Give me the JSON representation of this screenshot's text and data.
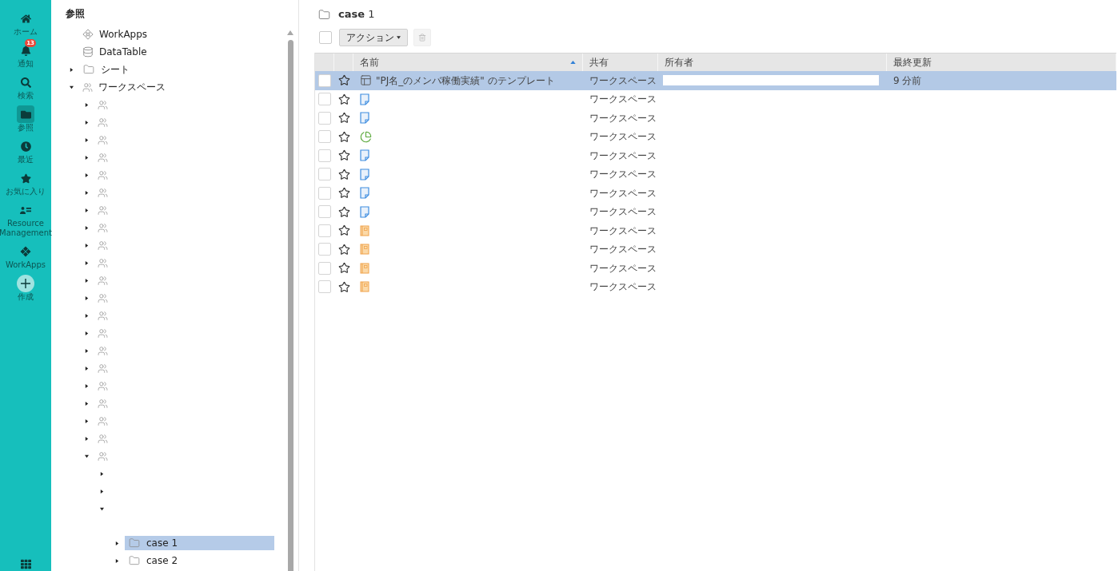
{
  "nav": {
    "items": [
      {
        "kind": "home",
        "label": "ホーム",
        "selected": false
      },
      {
        "kind": "bell",
        "label": "通知",
        "selected": false,
        "badge": "13"
      },
      {
        "kind": "search",
        "label": "検索",
        "selected": false
      },
      {
        "kind": "folder",
        "label": "参照",
        "selected": true
      },
      {
        "kind": "clock",
        "label": "最近",
        "selected": false
      },
      {
        "kind": "star",
        "label": "お気に入り",
        "selected": false
      },
      {
        "kind": "resource",
        "label": "Resource Management",
        "selected": false
      },
      {
        "kind": "workapps",
        "label": "WorkApps",
        "selected": false
      },
      {
        "kind": "create",
        "label": "作成",
        "selected": false
      }
    ]
  },
  "tree": {
    "title": "参照",
    "items": [
      {
        "kind": "workapps",
        "label": "WorkApps",
        "selected": false
      },
      {
        "kind": "database",
        "label": "DataTable",
        "selected": false
      },
      {
        "kind": "folder",
        "label": "シート",
        "expanded": false,
        "selected": false
      },
      {
        "kind": "workspace",
        "label": "ワークスペース",
        "expanded": true,
        "selected": false,
        "children": [
          {
            "kind": "workspace",
            "expanded": false,
            "selected": false
          },
          {
            "kind": "workspace",
            "expanded": false,
            "selected": false
          },
          {
            "kind": "workspace",
            "expanded": false,
            "selected": false
          },
          {
            "kind": "workspace",
            "expanded": false,
            "selected": false
          },
          {
            "kind": "workspace",
            "expanded": false,
            "selected": false
          },
          {
            "kind": "workspace",
            "expanded": false,
            "selected": false
          },
          {
            "kind": "workspace",
            "expanded": false,
            "selected": false
          },
          {
            "kind": "workspace",
            "expanded": false,
            "selected": false
          },
          {
            "kind": "workspace",
            "expanded": false,
            "selected": false
          },
          {
            "kind": "workspace",
            "expanded": false,
            "selected": false
          },
          {
            "kind": "workspace",
            "expanded": false,
            "selected": false
          },
          {
            "kind": "workspace",
            "expanded": false,
            "selected": false
          },
          {
            "kind": "workspace",
            "expanded": false,
            "selected": false
          },
          {
            "kind": "workspace",
            "expanded": false,
            "selected": false
          },
          {
            "kind": "workspace",
            "expanded": false,
            "selected": false
          },
          {
            "kind": "workspace",
            "expanded": false,
            "selected": false
          },
          {
            "kind": "workspace",
            "expanded": false,
            "selected": false
          },
          {
            "kind": "workspace",
            "expanded": false,
            "selected": false
          },
          {
            "kind": "workspace",
            "expanded": false,
            "selected": false
          },
          {
            "kind": "workspace",
            "expanded": false,
            "selected": false
          },
          {
            "kind": "workspace",
            "expanded": true,
            "selected": false,
            "children": [
              {
                "kind": "blank",
                "expanded": false
              },
              {
                "kind": "blank",
                "expanded": false
              },
              {
                "kind": "blank",
                "expanded": true,
                "children": [
                  {
                    "kind": "folder",
                    "label": "case 1",
                    "expanded": false,
                    "selected": true
                  },
                  {
                    "kind": "folder",
                    "label": "case 2",
                    "expanded": false,
                    "selected": false
                  }
                ]
              }
            ]
          }
        ]
      }
    ]
  },
  "main": {
    "title": "**case** 1",
    "select_all_checked": false,
    "action_button": "アクション",
    "delete_disabled": true,
    "table": {
      "columns": [
        {
          "label": "名前",
          "sort_ascending": true
        },
        {
          "label": "共有"
        },
        {
          "label": "所有者"
        },
        {
          "label": "最終更新"
        }
      ],
      "rows": [
        {
          "kind": "template",
          "name": "\"PJ名_のメンバ稼働実績\" のテンプレート",
          "share": "ワークスペース",
          "owner_hidden": true,
          "updated": "9 分前",
          "selected": true,
          "checked": false,
          "starred": false
        },
        {
          "kind": "document",
          "share": "ワークスペース",
          "selected": false,
          "checked": false,
          "starred": false
        },
        {
          "kind": "document",
          "share": "ワークスペース",
          "selected": false,
          "checked": false,
          "starred": false
        },
        {
          "kind": "chart",
          "share": "ワークスペース",
          "selected": false,
          "checked": false,
          "starred": false
        },
        {
          "kind": "document",
          "share": "ワークスペース",
          "selected": false,
          "checked": false,
          "starred": false
        },
        {
          "kind": "document",
          "share": "ワークスペース",
          "selected": false,
          "checked": false,
          "starred": false
        },
        {
          "kind": "document",
          "share": "ワークスペース",
          "selected": false,
          "checked": false,
          "starred": false
        },
        {
          "kind": "document",
          "share": "ワークスペース",
          "selected": false,
          "checked": false,
          "starred": false
        },
        {
          "kind": "notebook",
          "share": "ワークスペース",
          "selected": false,
          "checked": false,
          "starred": false
        },
        {
          "kind": "notebook",
          "share": "ワークスペース",
          "selected": false,
          "checked": false,
          "starred": false
        },
        {
          "kind": "notebook",
          "share": "ワークスペース",
          "selected": false,
          "checked": false,
          "starred": false
        },
        {
          "kind": "notebook",
          "share": "ワークスペース",
          "selected": false,
          "checked": false,
          "starred": false
        }
      ]
    }
  }
}
